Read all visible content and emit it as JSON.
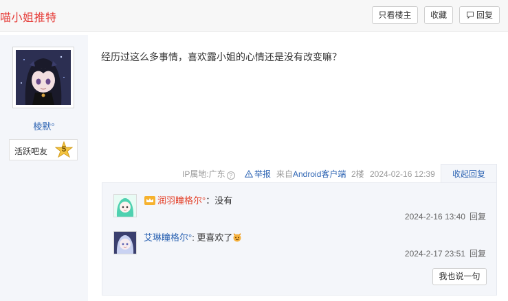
{
  "header": {
    "thread_title": "喵小姐推特",
    "only_author_label": "只看楼主",
    "favorite_label": "收藏",
    "reply_label": "回复"
  },
  "user": {
    "name": "棱默°",
    "rank_title": "活跃吧友",
    "rank_level": "5"
  },
  "post": {
    "content": "经历过这么多事情，喜欢露小姐的心情还是没有改变嘛？",
    "ip_location": "IP属地:广东",
    "report_label": "举报",
    "client_prefix": "来自",
    "client_name": "Android客户端",
    "floor": "2楼",
    "datetime": "2024-02-16 12:39",
    "collapse_label": "收起回复"
  },
  "comments": [
    {
      "user": "润羽瞳格尔°",
      "text": "：没有",
      "time": "2024-2-16 13:40",
      "reply_label": "回复"
    },
    {
      "user": "艾琳瞳格尔°",
      "text": ": 更喜欢了",
      "time": "2024-2-17 23:51",
      "reply_label": "回复"
    }
  ],
  "say_button_label": "我也说一句",
  "icons": {
    "report": "warning-triangle-icon",
    "reply": "speech-bubble-icon",
    "help": "question-circle-icon",
    "vip": "vip-crown-icon",
    "emoji": "cat-face-emoji"
  },
  "colors": {
    "title_red": "#e53935",
    "link_blue": "#2d64b3",
    "panel_bg": "#f4f6fa"
  }
}
